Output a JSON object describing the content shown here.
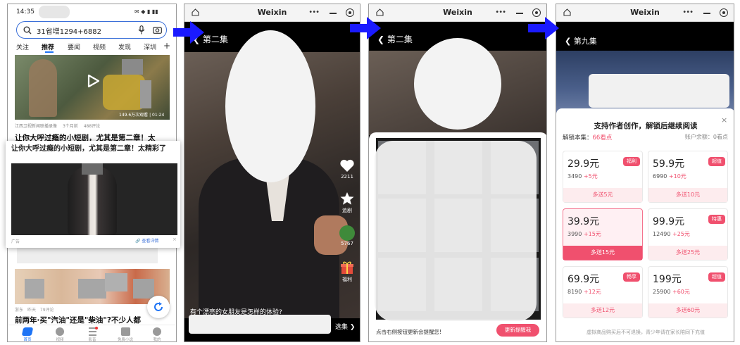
{
  "phone": {
    "time": "14:35",
    "search_query": "31省增1294+6882",
    "tabs": [
      "关注",
      "推荐",
      "要闻",
      "视频",
      "发现",
      "深圳"
    ],
    "video_caption": "江西卫视新闻联播录像",
    "video_meta_mid": "3个月前",
    "video_meta_right": "488评论",
    "video_overlay_text": "149.6万次观看 | 01:24",
    "headline": "让你大呼过瘾的小短剧，尤其是第二章！太",
    "popup_title": "让你大呼过瘾的小短剧，尤其是第二章！太精彩了",
    "popup_ad_label": "广告",
    "popup_detail_link": "查看详情",
    "news_meta": [
      "浙东",
      "昨天",
      "79评论"
    ],
    "bottom_headline": "前两年·买\"汽油\"还是\"柴油\"?不少人都",
    "nav_items": [
      "首页",
      "视频",
      "影音",
      "免费小说",
      "我的"
    ]
  },
  "weixin": {
    "title": "Weixin",
    "episode_2": "第二集",
    "episode_9": "第九集"
  },
  "video": {
    "likes": "2211",
    "fav_label": "追剧",
    "share_count": "5767",
    "gift_label": "福利",
    "subtitle": "有个漂亮的女朋友是怎样的体验?",
    "select_label": "选集"
  },
  "lockscreen": {
    "tip": "点击右侧按钮更新会提醒您!",
    "button": "更新提醒我"
  },
  "paywall": {
    "title": "支持作者创作，解锁后继续阅读",
    "unlock_label": "解锁本集：",
    "unlock_cost": "66看点",
    "balance": "账户余额：0看点",
    "footer": "虚拟商品购买后不可退换，青少年请在家长陪同下充值",
    "plans": [
      {
        "price": "29.9元",
        "base": "3490",
        "bonus": "+5元",
        "tag": "福利",
        "bottom": "多送5元"
      },
      {
        "price": "59.9元",
        "base": "6990",
        "bonus": "+10元",
        "tag": "超值",
        "bottom": "多送10元"
      },
      {
        "price": "39.9元",
        "base": "3990",
        "bonus": "+15元",
        "tag": "",
        "bottom": "多送15元"
      },
      {
        "price": "99.9元",
        "base": "12490",
        "bonus": "+25元",
        "tag": "特惠",
        "bottom": "多送25元"
      },
      {
        "price": "69.9元",
        "base": "8190",
        "bonus": "+12元",
        "tag": "畅享",
        "bottom": "多送12元"
      },
      {
        "price": "199元",
        "base": "25900",
        "bonus": "+60元",
        "tag": "超值",
        "bottom": "多送60元"
      }
    ]
  },
  "colors": {
    "accent_pink": "#f0506e",
    "arrow_blue": "#1a1aff",
    "selected_blue": "#1e74f5"
  }
}
